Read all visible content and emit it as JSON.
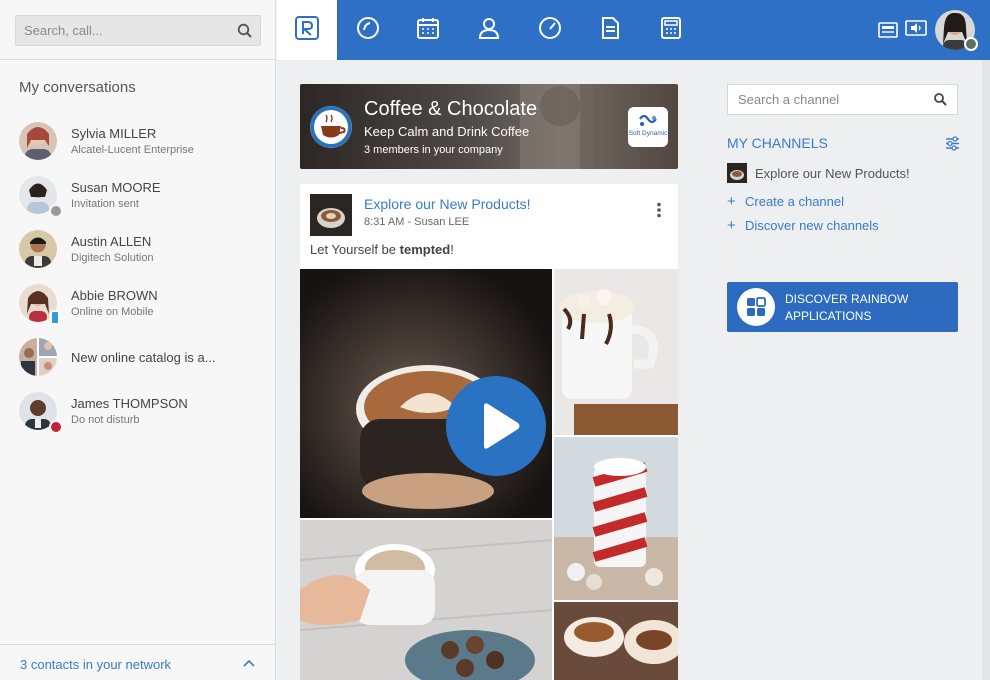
{
  "sidebar": {
    "search_placeholder": "Search, call...",
    "title": "My conversations",
    "conversations": [
      {
        "name": "Sylvia MILLER",
        "sub": "Alcatel-Lucent Enterprise"
      },
      {
        "name": "Susan MOORE",
        "sub": "Invitation sent"
      },
      {
        "name": "Austin ALLEN",
        "sub": "Digitech Solution"
      },
      {
        "name": "Abbie BROWN",
        "sub": "Online on Mobile"
      },
      {
        "name": "New online catalog is a..."
      },
      {
        "name": "James THOMPSON",
        "sub": "Do not disturb"
      }
    ],
    "footer": "3 contacts in your network"
  },
  "topbar": {
    "tabs": [
      "rainbow-logo-icon",
      "recent-icon",
      "calendar-icon",
      "contacts-icon",
      "dashboard-icon",
      "document-icon",
      "phone-dialpad-icon"
    ],
    "accent": "#2f70c7"
  },
  "channel_banner": {
    "title": "Coffee & Chocolate",
    "subtitle": "Keep Calm and Drink Coffee",
    "members": "3 members in your company",
    "company_logo_text": "Soft Dynamic"
  },
  "post": {
    "title": "Explore our New Products!",
    "meta": "8:31 AM - Susan LEE",
    "text_prefix": "Let Yourself be ",
    "text_bold": "tempted",
    "text_suffix": "!"
  },
  "right_panel": {
    "search_placeholder": "Search a channel",
    "my_channels": "MY CHANNELS",
    "channel_item": "Explore our New Products!",
    "create_channel": "Create a channel",
    "discover_channels": "Discover new channels",
    "discover_button": "DISCOVER RAINBOW APPLICATIONS"
  },
  "colors": {
    "brand_blue": "#2f70c7",
    "link_blue": "#3a7bc8",
    "online": "#2f9ad8",
    "dnd": "#c0233a"
  }
}
